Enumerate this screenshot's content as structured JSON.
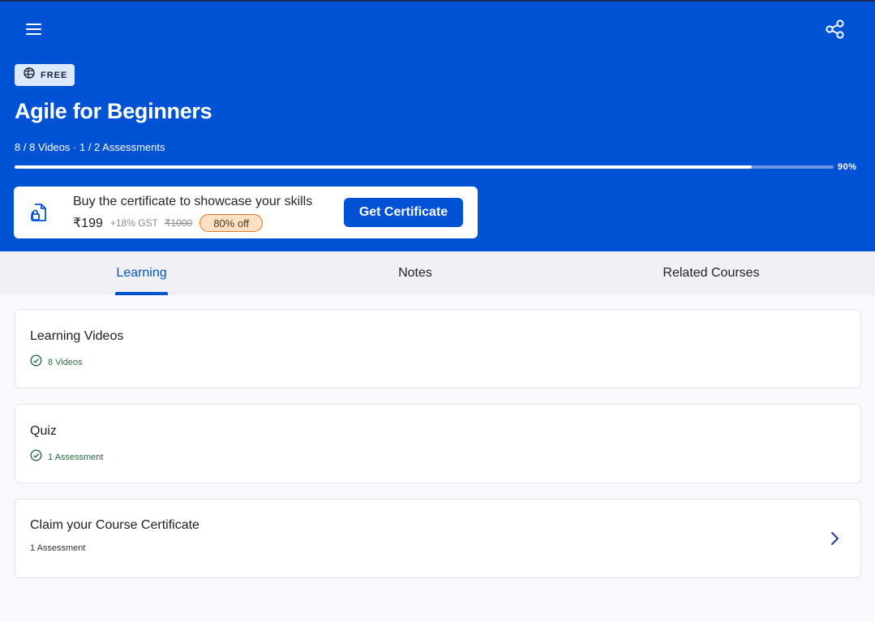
{
  "header": {
    "menu_icon": "hamburger-menu-icon",
    "share_icon": "share-icon",
    "badge": {
      "icon": "globe-icon",
      "label": "FREE"
    },
    "title": "Agile for Beginners",
    "meta": "8 / 8 Videos · 1 / 2 Assessments",
    "progress": {
      "percent": 90,
      "label": "90%"
    },
    "colors": {
      "brand": "#0052d4",
      "badge_bg": "#dce9fb"
    }
  },
  "certificate_banner": {
    "icon": "certificate-icon",
    "text": "Buy the certificate to showcase your skills",
    "price": "₹199",
    "gst": "+18% GST",
    "original_price": "₹1000",
    "discount": "80% off",
    "button_label": "Get Certificate"
  },
  "tabs": [
    {
      "label": "Learning",
      "active": true
    },
    {
      "label": "Notes",
      "active": false
    },
    {
      "label": "Related Courses",
      "active": false
    }
  ],
  "sections": [
    {
      "title": "Learning Videos",
      "subtitle": "8 Videos",
      "status_icon": "check-circle-icon",
      "completed": true
    },
    {
      "title": "Quiz",
      "subtitle": "1 Assessment",
      "status_icon": "check-circle-icon",
      "completed": true
    },
    {
      "title": "Claim your Course Certificate",
      "subtitle": "1 Assessment",
      "action_icon": "chevron-right-icon",
      "completed": false
    }
  ]
}
